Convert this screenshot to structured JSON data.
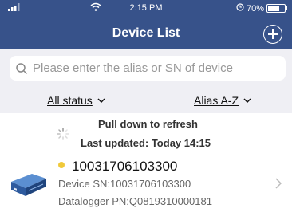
{
  "status_bar": {
    "time": "2:15 PM",
    "battery": "70%"
  },
  "header": {
    "title": "Device List"
  },
  "search": {
    "placeholder": "Please enter the alias or SN of device"
  },
  "filters": {
    "status_label": "All status",
    "sort_label": "Alias A-Z"
  },
  "refresh": {
    "pull_text": "Pull down to refresh",
    "last_updated": "Last updated: Today 14:15"
  },
  "device": {
    "name": "10031706103300",
    "sn": "Device SN:10031706103300",
    "pn": "Datalogger PN:Q0819310000181",
    "status_color": "#f0c93a"
  },
  "colors": {
    "header_bg": "#37528a",
    "filter_bg": "#efeff4"
  },
  "icons": [
    "signal-icon",
    "wifi-icon",
    "alarm-icon",
    "battery-icon",
    "add-icon",
    "search-icon",
    "chevron-down-icon",
    "spinner-icon",
    "device-image",
    "chevron-right-icon"
  ]
}
